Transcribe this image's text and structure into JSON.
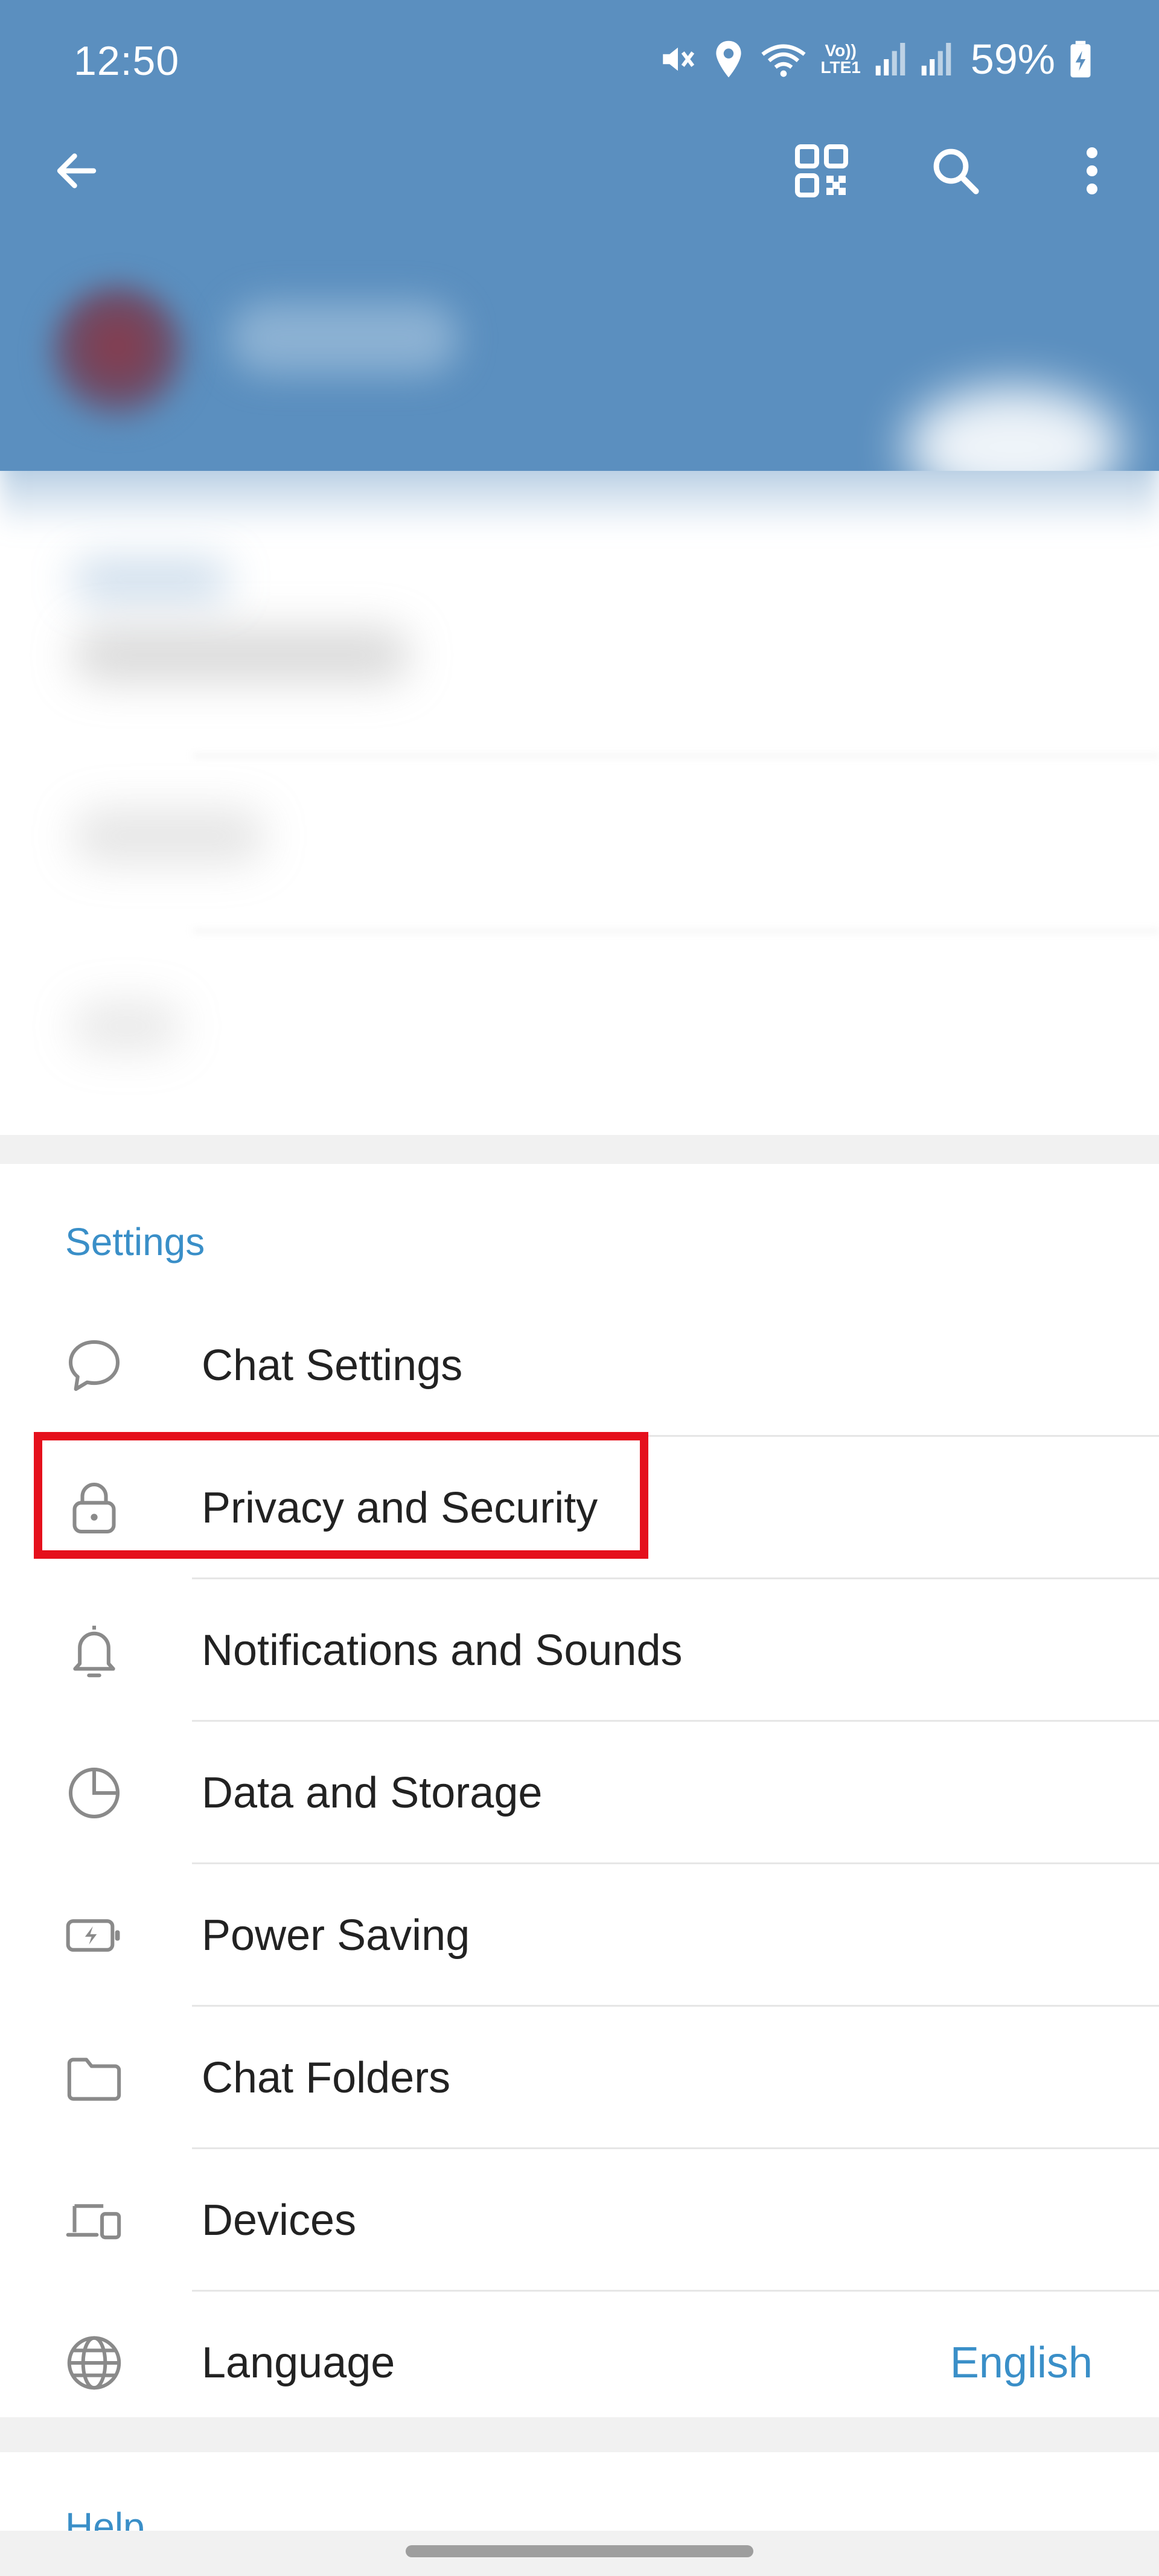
{
  "status_bar": {
    "time": "12:50",
    "battery_percent": "59%",
    "icons": [
      "mute-icon",
      "location-icon",
      "wifi-icon",
      "volte-icon",
      "signal-icon",
      "signal-icon",
      "battery-charging-icon"
    ],
    "network_label_top": "Vo))",
    "network_label_bottom": "LTE1"
  },
  "toolbar": {
    "back_icon": "arrow-left-icon",
    "qr_icon": "qr-code-icon",
    "search_icon": "search-icon",
    "more_icon": "more-vertical-icon"
  },
  "settings": {
    "header": "Settings",
    "items": [
      {
        "label": "Chat Settings",
        "icon": "chat-bubble-icon"
      },
      {
        "label": "Privacy and Security",
        "icon": "lock-icon"
      },
      {
        "label": "Notifications and Sounds",
        "icon": "bell-icon"
      },
      {
        "label": "Data and Storage",
        "icon": "pie-chart-icon"
      },
      {
        "label": "Power Saving",
        "icon": "battery-bolt-icon"
      },
      {
        "label": "Chat Folders",
        "icon": "folder-icon"
      },
      {
        "label": "Devices",
        "icon": "devices-icon"
      },
      {
        "label": "Language",
        "icon": "globe-icon",
        "value": "English"
      }
    ]
  },
  "help": {
    "header": "Help"
  },
  "colors": {
    "header_bg": "#5b8fbf",
    "accent": "#3a8fc8",
    "highlight": "#e5101c",
    "text": "#222222",
    "icon": "#8a8a8a"
  }
}
